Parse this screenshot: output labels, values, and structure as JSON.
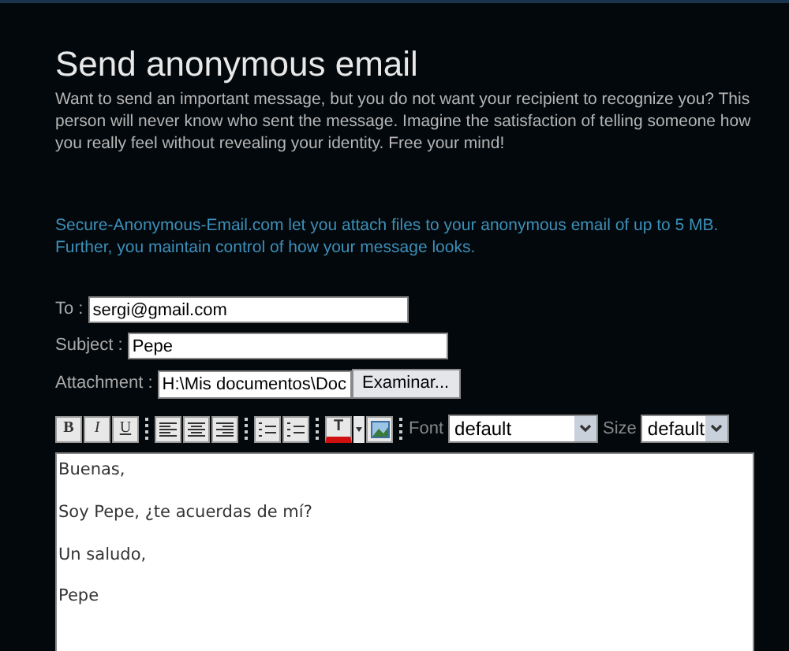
{
  "title": "Send anonymous email",
  "intro": "Want to send an important message, but you do not want your recipient to recognize you? This person will never know who sent the message. Imagine the satisfaction of telling someone how you really feel without revealing your identity. Free your mind!",
  "attachment_note": "Secure-Anonymous-Email.com let you attach files to your anonymous email of up to 5 MB. Further, you maintain control of how your message looks.",
  "fields": [
    {
      "label": "To :",
      "value": "sergi@gmail.com"
    },
    {
      "label": "Subject :",
      "value": "Pepe"
    }
  ],
  "attachment": {
    "label": "Attachment :",
    "value": "H:\\Mis documentos\\Doc",
    "button": "Examinar..."
  },
  "toolbar": {
    "format_buttons": [
      {
        "kind": "bold",
        "label": "B"
      },
      {
        "kind": "italic",
        "label": "I"
      },
      {
        "kind": "underline",
        "label": "U"
      }
    ],
    "color_button": "T",
    "font": {
      "label": "Font",
      "value": "default"
    },
    "size": {
      "label": "Size",
      "value": "default"
    }
  },
  "message": [
    "Buenas,",
    "Soy Pepe, ¿te acuerdas de mí?",
    "Un saludo,",
    "Pepe"
  ]
}
